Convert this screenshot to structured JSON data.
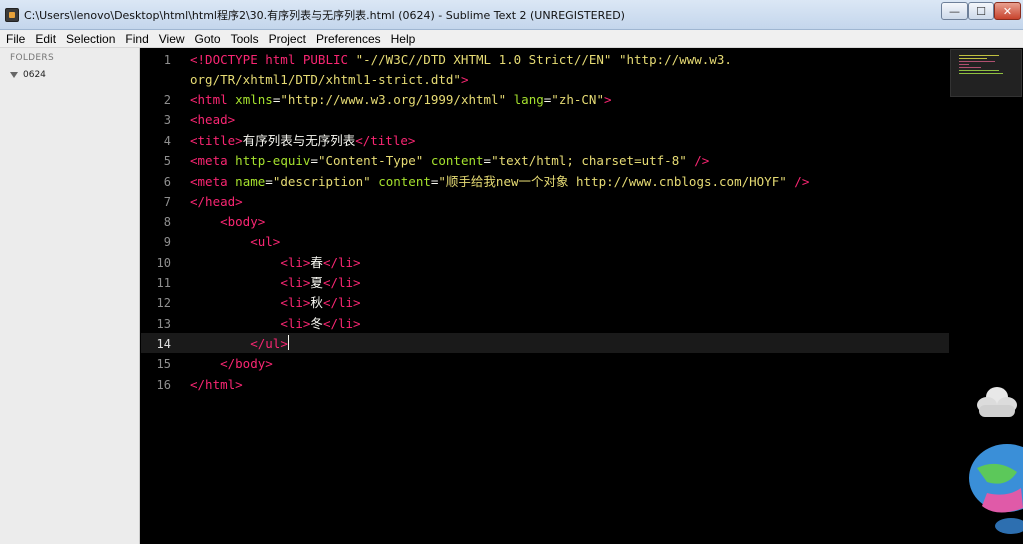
{
  "window": {
    "title": "C:\\Users\\lenovo\\Desktop\\html\\html程序2\\30.有序列表与无序列表.html (0624) - Sublime Text 2 (UNREGISTERED)",
    "min_label": "—",
    "max_label": "☐",
    "close_label": "✕"
  },
  "menu": {
    "items": [
      "File",
      "Edit",
      "Selection",
      "Find",
      "View",
      "Goto",
      "Tools",
      "Project",
      "Preferences",
      "Help"
    ]
  },
  "sidebar": {
    "header": "FOLDERS",
    "folder": "0624"
  },
  "editor": {
    "line_numbers": [
      "1",
      "",
      "2",
      "3",
      "4",
      "5",
      "6",
      "7",
      "8",
      "9",
      "10",
      "11",
      "12",
      "13",
      "14",
      "15",
      "16"
    ],
    "current_line": "14"
  },
  "colors": {
    "tag": "#f92672",
    "attr": "#a6e22e",
    "string": "#e6db74",
    "text": "#f8f8f2",
    "background": "#000000",
    "sidebar": "#ececec"
  },
  "icons": [
    "app-icon",
    "minimize-icon",
    "maximize-icon",
    "close-icon",
    "folder-expand-icon",
    "cloud-icon",
    "globe-icon"
  ]
}
